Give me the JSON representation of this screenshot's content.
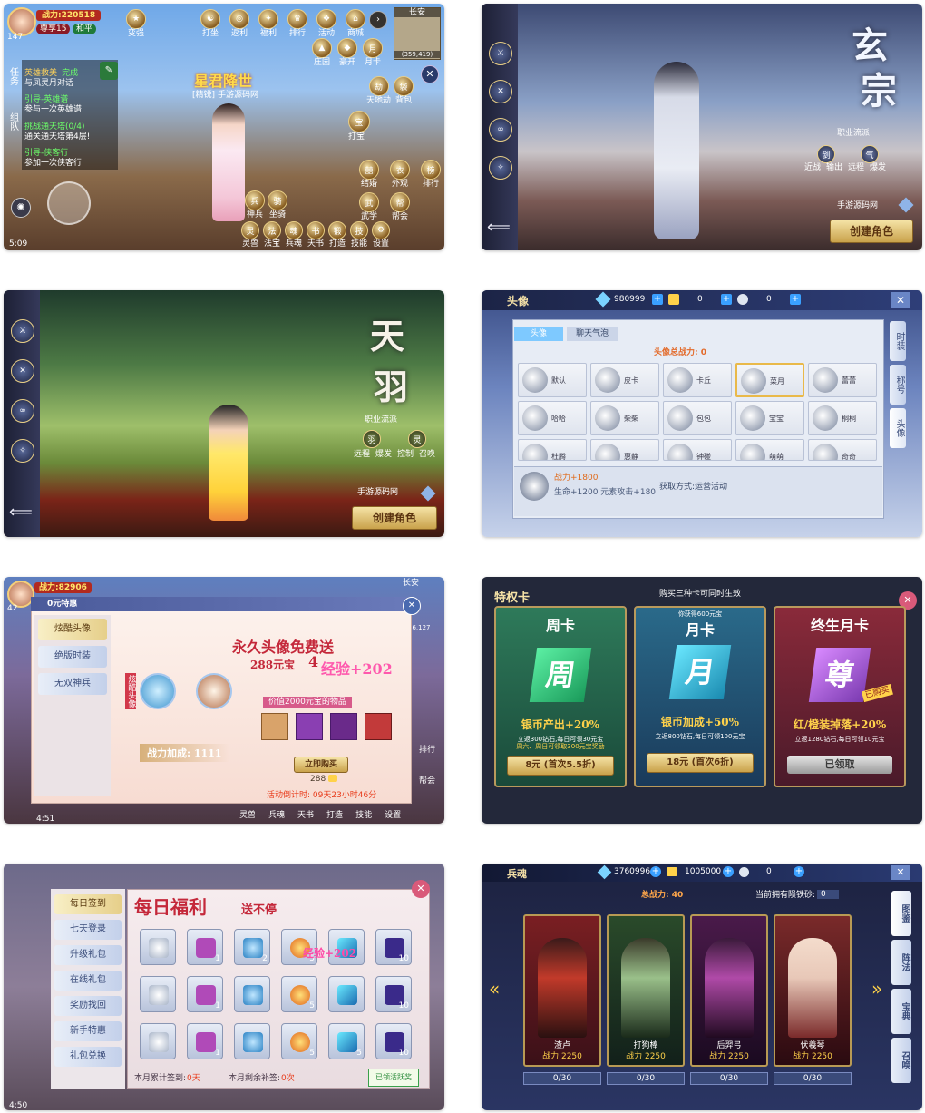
{
  "panel1": {
    "power_label": "战力:220518",
    "level": "147",
    "vip": "尊享15",
    "server": "和平",
    "location": "长安",
    "coords": "(359,419)",
    "quest_tab": "任务",
    "team_tab": "组队",
    "quests": [
      {
        "title": "英雄救美",
        "status": "完成",
        "desc": "与凤灵月对话"
      },
      {
        "title": "引导-英雄谱",
        "desc": "参与一次英雄谱"
      },
      {
        "title": "挑战通天塔(0/4)",
        "desc": "通关通天塔第4层!"
      },
      {
        "title": "引导-侠客行",
        "desc": "参加一次侠客行"
      }
    ],
    "top_menu": [
      "变强",
      "打坐",
      "返利",
      "福利",
      "排行",
      "活动",
      "商城"
    ],
    "top_menu2": [
      "庄园",
      "豪开",
      "月卡",
      "天地劫",
      "背包"
    ],
    "player_title": "星君降世",
    "player_name": "手游源码网",
    "player_guild": "[精锐]",
    "right_menu": [
      "打宝",
      "结婚",
      "外观",
      "排行",
      "武学",
      "帮会",
      "神兵",
      "坐骑",
      "技能",
      "设置",
      "灵兽",
      "法宝",
      "兵魂",
      "天书",
      "打造"
    ],
    "time": "5:09"
  },
  "panel2": {
    "title_char1": "玄",
    "title_char2": "宗",
    "subtitle": "职业流派",
    "skills": [
      "剑",
      "气"
    ],
    "tags": [
      "近战",
      "输出",
      "远程",
      "爆发"
    ],
    "watermark": "手游源码网",
    "create_button": "创建角色"
  },
  "panel3": {
    "title_char1": "天",
    "title_char2": "羽",
    "subtitle": "职业流派",
    "skills": [
      "羽",
      "灵"
    ],
    "tags": [
      "远程",
      "爆发",
      "控制",
      "召唤"
    ],
    "watermark": "手游源码网",
    "create_button": "创建角色"
  },
  "panel4": {
    "window_title": "头像",
    "diamonds": "980999",
    "gold": "0",
    "silver": "0",
    "tabs": [
      "头像",
      "聊天气泡"
    ],
    "avatar_power": "头像总战力: 0",
    "avatars": [
      "默认",
      "皮卡",
      "卡丘",
      "菜月",
      "蕾蕾",
      "哈哈",
      "柴柴",
      "包包",
      "宝宝",
      "桐桐",
      "杜腾",
      "惠静",
      "钟碰",
      "萌萌",
      "奇奇"
    ],
    "side_tabs": [
      "时装",
      "称号",
      "头像"
    ],
    "detail_power": "战力+1800",
    "detail_stats": "生命+1200  元素攻击+180",
    "detail_source": "获取方式:运营活动"
  },
  "panel5": {
    "power_label": "战力:82906",
    "level": "42",
    "location": "长安",
    "coords": "46,127",
    "window_title": "0元特惠",
    "menu": [
      "炫酷头像",
      "绝版时装",
      "无双神兵"
    ],
    "headline": "永久头像免费送",
    "subline": "288元宝",
    "sub_deco": "4",
    "ribbon": "炫酷头像",
    "watermark": "经验+202",
    "value_label": "价值2000元宝的物品",
    "power_bonus": "战力加成: 1111",
    "buy_button": "立即购买",
    "price": "288",
    "countdown": "活动倒计时: 09天23小时46分",
    "bottom_menu": [
      "灵兽",
      "兵魂",
      "天书",
      "打造",
      "技能",
      "设置"
    ],
    "side_items": [
      "排行",
      "帮会"
    ],
    "time": "4:51"
  },
  "panel6": {
    "header": "特权卡",
    "notice": "购买三种卡可同时生效",
    "cards": [
      {
        "title": "周卡",
        "glyph": "周",
        "bonus": "银币产出+20%",
        "line1": "立返300钻石,每日可领30元宝",
        "line2": "周六、周日可领取300元宝奖励",
        "price": "8元 (首次5.5折)"
      },
      {
        "title": "月卡",
        "glyph": "月",
        "top_note": "你获得600元宝",
        "bonus": "银币加成+50%",
        "line1": "立返800钻石,每日可领100元宝",
        "line2": "",
        "price": "18元 (首次6折)"
      },
      {
        "title": "终生月卡",
        "glyph": "尊",
        "badge": "已购买",
        "bonus": "红/橙装掉落+20%",
        "line1": "立返1280钻石,每日可领10元宝",
        "line2": "",
        "price": "已领取"
      }
    ]
  },
  "panel7": {
    "menu": [
      "每日签到",
      "七天登录",
      "升级礼包",
      "在线礼包",
      "奖励找回",
      "新手特惠",
      "礼包兑换"
    ],
    "headline": "每日福利",
    "subheadline": "送不停",
    "grid_counts": [
      "",
      "1",
      "2",
      "5",
      "",
      "10",
      "",
      "1",
      "",
      "5",
      "",
      "10",
      "",
      "1",
      "",
      "5",
      "5",
      "10"
    ],
    "signed_label": "本月累计签到:",
    "signed_value": "0天",
    "remedy_label": "本月剩余补签:",
    "remedy_value": "0次",
    "signed_button": "已领活跃奖",
    "watermark": "经验+202",
    "time": "4:50"
  },
  "panel8": {
    "window_title": "兵魂",
    "diamonds": "3760996",
    "gold": "1005000",
    "silver": "0",
    "total_power": "总战力: 40",
    "shards_label": "当前拥有陨铁砂:",
    "shards_value": "0",
    "souls": [
      {
        "name": "渣卢",
        "power": "战力 2250",
        "progress": "0/30"
      },
      {
        "name": "打狗棒",
        "power": "战力 2250",
        "progress": "0/30"
      },
      {
        "name": "后羿弓",
        "power": "战力 2250",
        "progress": "0/30"
      },
      {
        "name": "伏羲琴",
        "power": "战力 2250",
        "progress": "0/30"
      }
    ],
    "side_tabs": [
      "图鉴",
      "阵法",
      "宝典",
      "召唤"
    ]
  }
}
